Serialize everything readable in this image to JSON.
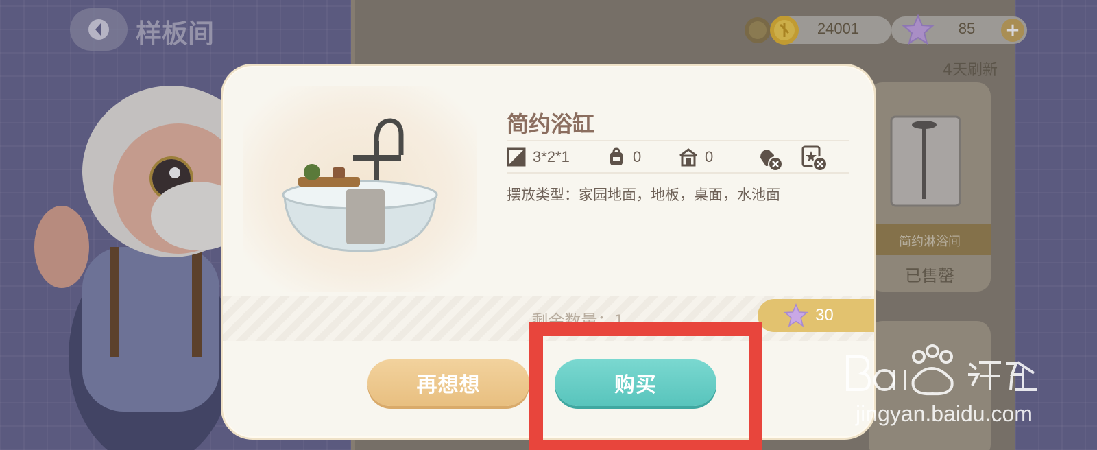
{
  "header": {
    "title": "样板间",
    "back_icon": "back-arrow-icon"
  },
  "currency": {
    "coins": "24001",
    "stars": "85",
    "plus": "+"
  },
  "shop": {
    "refresh": "4天刷新",
    "side_item": {
      "name": "简约淋浴间",
      "status": "已售罄"
    }
  },
  "dialog": {
    "item_name": "简约浴缸",
    "stats": {
      "size": "3*2*1",
      "backpack": "0",
      "home": "0"
    },
    "placement": "摆放类型：家园地面，地板，桌面，水池面",
    "remaining": "剩余数量：1",
    "price": "30",
    "cancel_label": "再想想",
    "buy_label": "购买"
  },
  "watermark": {
    "site": "jingyan.baidu.com"
  },
  "colors": {
    "accent_buy": "#58c4bc",
    "accent_cancel": "#e8bf80",
    "price_tag": "#e2c26f",
    "highlight": "#e8453c"
  }
}
